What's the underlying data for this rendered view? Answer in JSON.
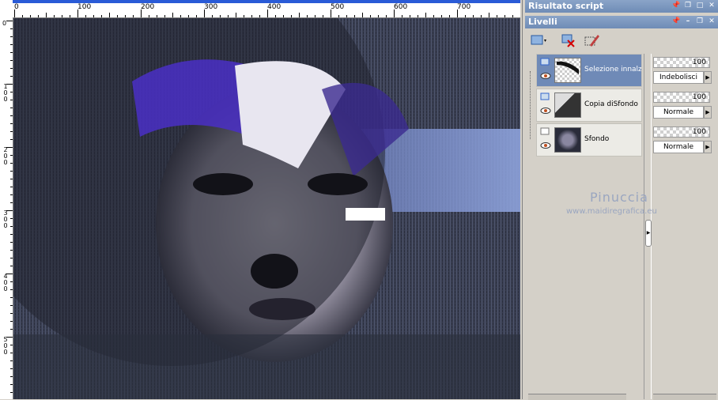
{
  "panels": {
    "script_output_title": "Risultato script",
    "layers_title": "Livelli"
  },
  "layers": [
    {
      "name": "Selezione innalzat",
      "opacity": "100",
      "blend": "Indebolisci",
      "selected": true
    },
    {
      "name": "Copia diSfondo",
      "opacity": "100",
      "blend": "Normale",
      "selected": false
    },
    {
      "name": "Sfondo",
      "opacity": "100",
      "blend": "Normale",
      "selected": false
    }
  ],
  "ruler": {
    "top_labels": [
      "0",
      "100",
      "200",
      "300",
      "400",
      "500",
      "600",
      "700"
    ],
    "left_labels": [
      "0",
      "100",
      "200",
      "300",
      "400",
      "500"
    ]
  },
  "watermark": {
    "name": "Pinuccia",
    "url": "www.maidiregrafica.eu"
  },
  "colors": {
    "selection_blue": "#6f8ab7",
    "titlebar_blue": "#7a95bf",
    "panel_gray": "#d4d0c8"
  }
}
